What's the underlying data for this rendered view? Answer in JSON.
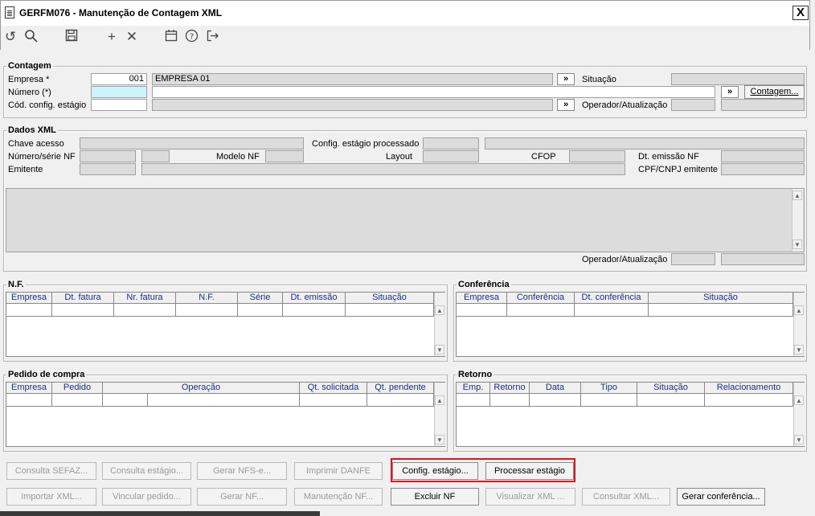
{
  "window": {
    "title": "GERFM076 - Manutenção de Contagem XML",
    "close_label": "X"
  },
  "toolbar": {
    "icons": [
      "refresh-icon",
      "search-icon",
      "save-icon",
      "add-icon",
      "delete-icon",
      "calendar-icon",
      "help-icon",
      "exit-icon"
    ]
  },
  "contagem": {
    "legend": "Contagem",
    "empresa_label": "Empresa *",
    "empresa_code": "001",
    "empresa_name": "EMPRESA 01",
    "numero_label": "Número (*)",
    "cod_config_label": "Cód. config. estágio",
    "situacao_label": "Situação",
    "operador_label": "Operador/Atualização",
    "contagem_btn": "Contagem...",
    "arrow_btn": "»"
  },
  "dados_xml": {
    "legend": "Dados XML",
    "chave_label": "Chave acesso",
    "config_processado_label": "Config. estágio processado",
    "numero_serie_label": "Número/série NF",
    "modelo_label": "Modelo NF",
    "layout_label": "Layout",
    "cfop_label": "CFOP",
    "dt_emissao_label": "Dt. emissão NF",
    "emitente_label": "Emitente",
    "cpf_cnpj_label": "CPF/CNPJ emitente",
    "operador_label": "Operador/Atualização"
  },
  "nf": {
    "legend": "N.F.",
    "columns": [
      "Empresa",
      "Dt. fatura",
      "Nr. fatura",
      "N.F.",
      "Série",
      "Dt. emissão",
      "Situação"
    ]
  },
  "conferencia": {
    "legend": "Conferência",
    "columns": [
      "Empresa",
      "Conferência",
      "Dt. conferência",
      "Situação"
    ]
  },
  "pedido": {
    "legend": "Pedido de compra",
    "columns": [
      "Empresa",
      "Pedido",
      "Operação",
      "Qt. solicitada",
      "Qt. pendente"
    ]
  },
  "retorno": {
    "legend": "Retorno",
    "columns": [
      "Emp.",
      "Retorno",
      "Data",
      "Tipo",
      "Situação",
      "Relacionamento"
    ]
  },
  "buttons_row1": [
    "Consulta SEFAZ...",
    "Consulta estágio...",
    "Gerar NFS-e...",
    "Imprimir DANFE",
    "Config. estágio...",
    "Processar estágio"
  ],
  "buttons_row2": [
    "Importar XML...",
    "Vincular pedido...",
    "Gerar NF...",
    "Manutenção NF...",
    "Excluir NF",
    "Visualizar XML ...",
    "Consultar XML...",
    "Gerar conferência..."
  ],
  "colors": {
    "highlight_box": "#e0121b",
    "header_text": "#1a2f8a",
    "required_field": "#ccf4fa"
  }
}
